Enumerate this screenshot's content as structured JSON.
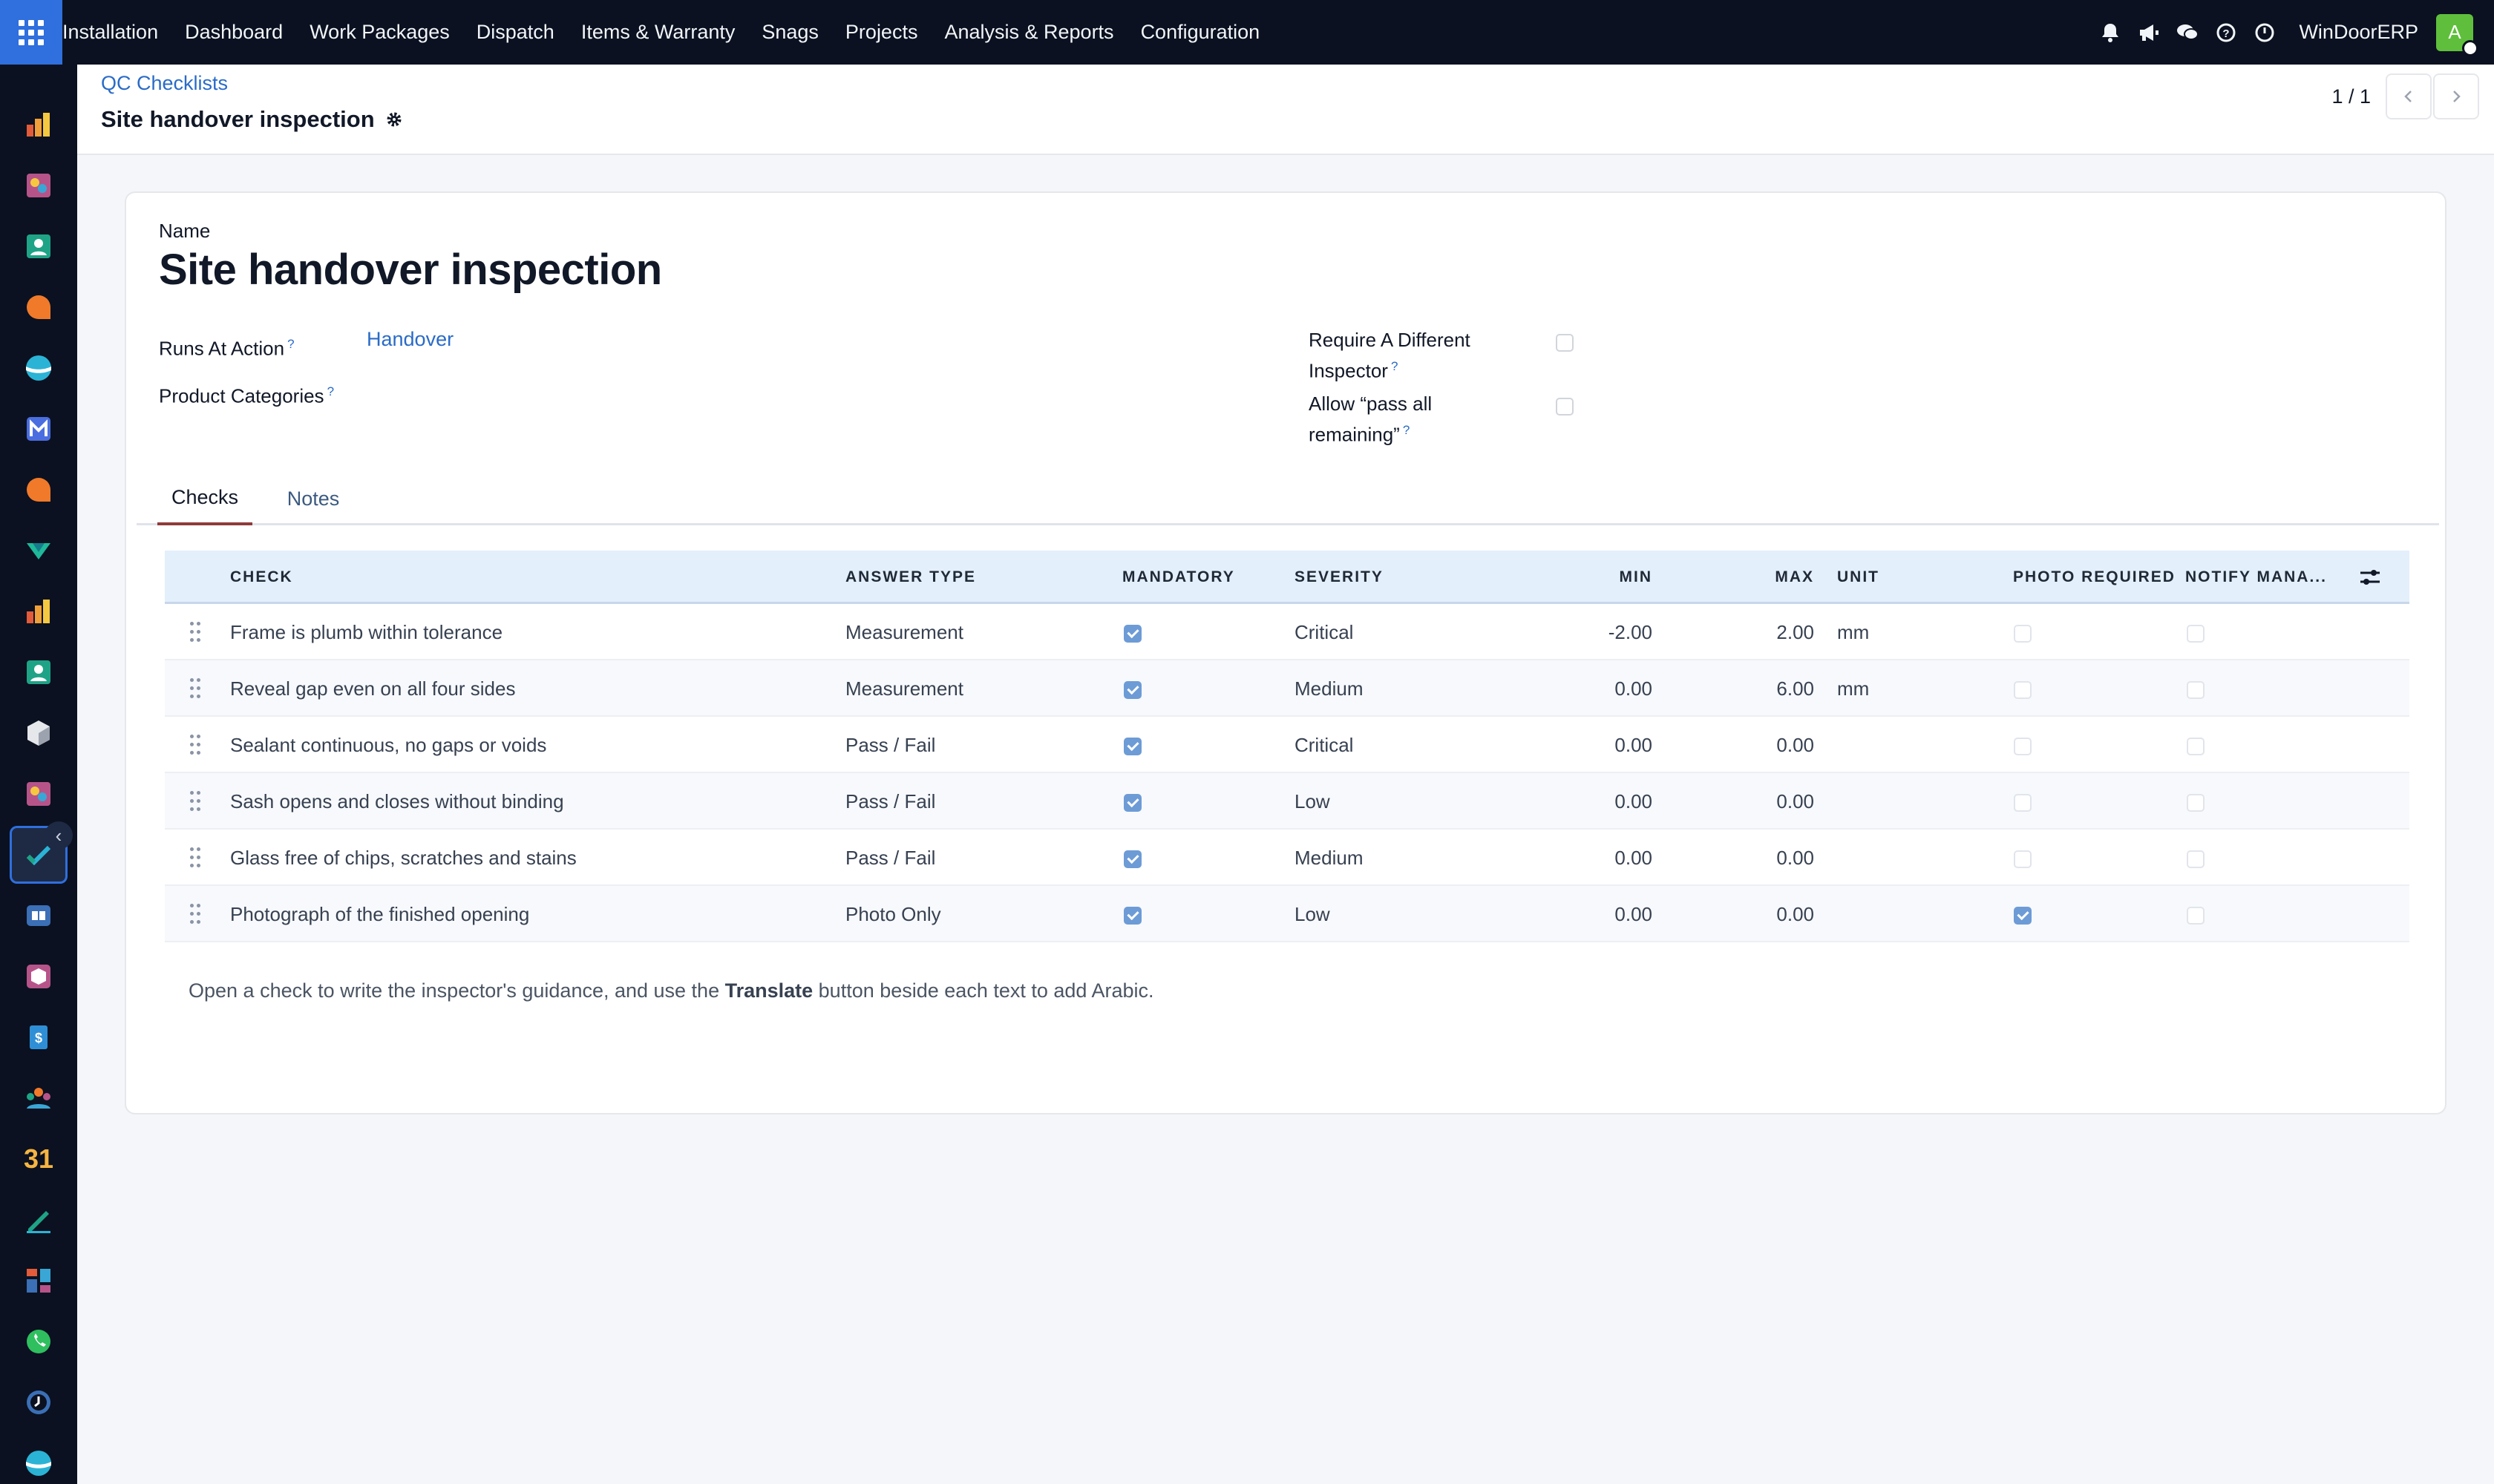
{
  "topbar": {
    "app_name": "Installation",
    "menu": [
      "Dashboard",
      "Work Packages",
      "Dispatch",
      "Items & Warranty",
      "Snags",
      "Projects",
      "Analysis & Reports",
      "Configuration"
    ],
    "company": "WinDoorERP",
    "avatar_initial": "A"
  },
  "sidebar_icons": [
    "bar-chart-app-icon",
    "palette-app-icon",
    "contacts-app-icon",
    "discuss-app-icon",
    "sphere-app-icon",
    "mail-app-icon",
    "chat-app-icon",
    "field-service-app-icon",
    "reports-app-icon",
    "contacts-book-app-icon",
    "cube-app-icon",
    "colors-app-icon",
    "quality-check-app-icon",
    "knowledge-app-icon",
    "box-app-icon",
    "sales-app-icon",
    "employees-app-icon",
    "calendar-app-icon",
    "sign-app-icon",
    "dashboards-app-icon",
    "whatsapp-app-icon",
    "timer-app-icon",
    "sphere2-app-icon"
  ],
  "calendar_label": "31",
  "breadcrumb": "QC Checklists",
  "record_title": "Site handover inspection",
  "pager": "1 / 1",
  "form": {
    "name_label": "Name",
    "name_value": "Site handover inspection",
    "runs_at_label": "Runs At Action",
    "runs_at_value": "Handover",
    "product_categories_label": "Product Categories",
    "require_inspector_label_1": "Require A Different",
    "require_inspector_label_2": "Inspector",
    "allow_pass_label_1": "Allow “pass all",
    "allow_pass_label_2": "remaining”",
    "help_mark": "?"
  },
  "tabs": [
    "Checks",
    "Notes"
  ],
  "table": {
    "columns": [
      "CHECK",
      "ANSWER TYPE",
      "MANDATORY",
      "SEVERITY",
      "MIN",
      "MAX",
      "UNIT",
      "PHOTO REQUIRED",
      "NOTIFY MANA..."
    ],
    "rows": [
      {
        "check": "Frame is plumb within tolerance",
        "answer_type": "Measurement",
        "mandatory": true,
        "severity": "Critical",
        "min": "-2.00",
        "max": "2.00",
        "unit": "mm",
        "photo_required": false,
        "notify": false
      },
      {
        "check": "Reveal gap even on all four sides",
        "answer_type": "Measurement",
        "mandatory": true,
        "severity": "Medium",
        "min": "0.00",
        "max": "6.00",
        "unit": "mm",
        "photo_required": false,
        "notify": false
      },
      {
        "check": "Sealant continuous, no gaps or voids",
        "answer_type": "Pass / Fail",
        "mandatory": true,
        "severity": "Critical",
        "min": "0.00",
        "max": "0.00",
        "unit": "",
        "photo_required": false,
        "notify": false
      },
      {
        "check": "Sash opens and closes without binding",
        "answer_type": "Pass / Fail",
        "mandatory": true,
        "severity": "Low",
        "min": "0.00",
        "max": "0.00",
        "unit": "",
        "photo_required": false,
        "notify": false
      },
      {
        "check": "Glass free of chips, scratches and stains",
        "answer_type": "Pass / Fail",
        "mandatory": true,
        "severity": "Medium",
        "min": "0.00",
        "max": "0.00",
        "unit": "",
        "photo_required": false,
        "notify": false
      },
      {
        "check": "Photograph of the finished opening",
        "answer_type": "Photo Only",
        "mandatory": true,
        "severity": "Low",
        "min": "0.00",
        "max": "0.00",
        "unit": "",
        "photo_required": true,
        "notify": false
      }
    ]
  },
  "hint": {
    "before": "Open a check to write the inspector's guidance, and use the ",
    "bold": "Translate",
    "after": " button beside each text to add Arabic."
  },
  "colors": {
    "topbar_bg": "#0b1120",
    "apps_button": "#2f6fde",
    "link": "#2a6bc7",
    "table_header_bg": "#e4effc",
    "checkbox_on": "#6d9bd6",
    "avatar": "#5fbf3c"
  }
}
